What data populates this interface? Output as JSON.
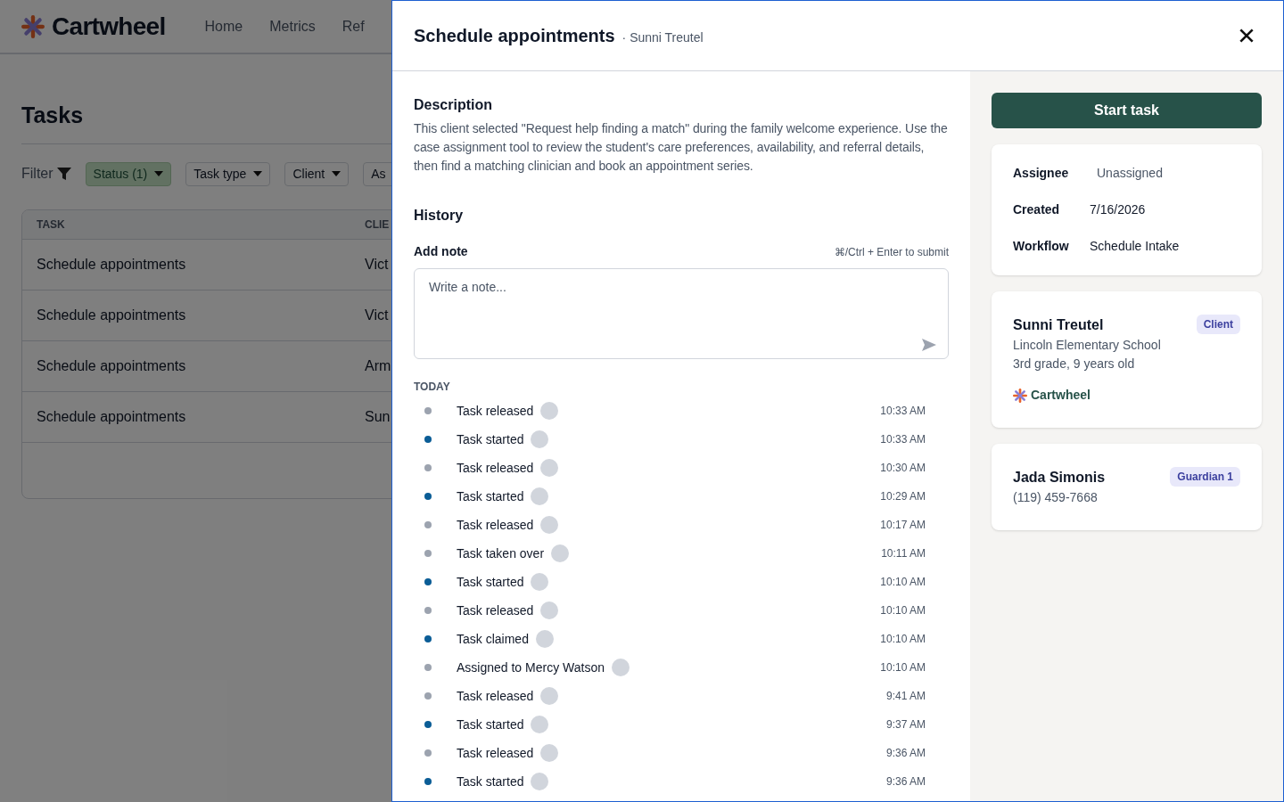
{
  "app": {
    "logo": "Cartwheel",
    "nav": [
      {
        "label": "Home",
        "selected": false
      },
      {
        "label": "Metrics",
        "selected": false
      },
      {
        "label": "Ref",
        "selected": false
      }
    ]
  },
  "tasks_page": {
    "title": "Tasks",
    "filter_label": "Filter",
    "filters": [
      {
        "label": "Status (1)",
        "active": true
      },
      {
        "label": "Task type",
        "active": false
      },
      {
        "label": "Client",
        "active": false
      },
      {
        "label": "As",
        "active": false
      }
    ],
    "table": {
      "columns": [
        "TASK",
        "CLIE"
      ],
      "rows": [
        [
          "Schedule appointments",
          "Vict"
        ],
        [
          "Schedule appointments",
          "Vict"
        ],
        [
          "Schedule appointments",
          "Arm"
        ],
        [
          "Schedule appointments",
          "Sun"
        ]
      ]
    }
  },
  "drawer": {
    "title": "Schedule appointments",
    "subtitle": "· Sunni Treutel",
    "description_heading": "Description",
    "description": "This client selected \"Request help finding a match\" during the family welcome experience. Use the case assignment tool to review the student's care preferences, availability, and referral details, then find a matching clinician and book an appointment series.",
    "history_heading": "History",
    "note_label": "Add note",
    "note_hint": "⌘/Ctrl + Enter to submit",
    "note_placeholder": "Write a note...",
    "day_label": "TODAY",
    "history": [
      {
        "text": "Task released",
        "time": "10:33 AM",
        "color": "#9ca3af"
      },
      {
        "text": "Task started",
        "time": "10:33 AM",
        "color": "#0b5d96"
      },
      {
        "text": "Task released",
        "time": "10:30 AM",
        "color": "#9ca3af"
      },
      {
        "text": "Task started",
        "time": "10:29 AM",
        "color": "#0b5d96"
      },
      {
        "text": "Task released",
        "time": "10:17 AM",
        "color": "#9ca3af"
      },
      {
        "text": "Task taken over",
        "time": "10:11 AM",
        "color": "#9ca3af"
      },
      {
        "text": "Task started",
        "time": "10:10 AM",
        "color": "#0b5d96"
      },
      {
        "text": "Task released",
        "time": "10:10 AM",
        "color": "#9ca3af"
      },
      {
        "text": "Task claimed",
        "time": "10:10 AM",
        "color": "#0b5d96"
      },
      {
        "text": "Assigned to Mercy Watson",
        "time": "10:10 AM",
        "color": "#9ca3af"
      },
      {
        "text": "Task released",
        "time": "9:41 AM",
        "color": "#9ca3af"
      },
      {
        "text": "Task started",
        "time": "9:37 AM",
        "color": "#0b5d96"
      },
      {
        "text": "Task released",
        "time": "9:36 AM",
        "color": "#9ca3af"
      },
      {
        "text": "Task started",
        "time": "9:36 AM",
        "color": "#0b5d96"
      }
    ],
    "start_button": "Start task",
    "details": [
      {
        "label": "Assignee",
        "value": "Unassigned",
        "muted": true
      },
      {
        "label": "Created",
        "value": "7/16/2026",
        "muted": false
      },
      {
        "label": "Workflow",
        "value": "Schedule Intake",
        "muted": false
      }
    ],
    "people": [
      {
        "name": "Sunni Treutel",
        "badge": "Client",
        "lines": [
          "Lincoln Elementary School",
          "3rd grade, 9 years old"
        ],
        "org": "Cartwheel"
      },
      {
        "name": "Jada Simonis",
        "badge": "Guardian 1",
        "lines": [
          "(119) 459-7668"
        ]
      }
    ]
  }
}
